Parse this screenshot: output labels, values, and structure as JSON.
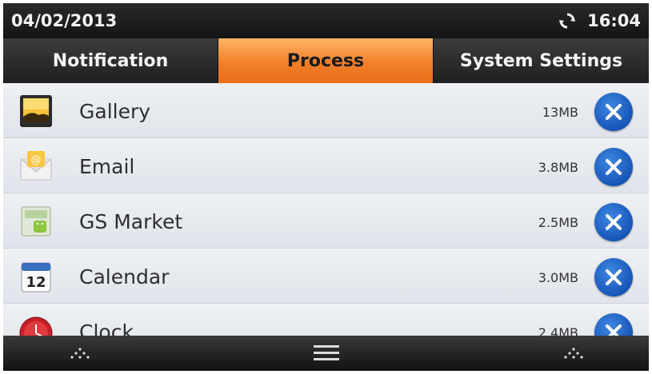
{
  "status_bar": {
    "date": "04/02/2013",
    "time": "16:04",
    "sync_icon": "sync-icon"
  },
  "tabs": [
    {
      "label": "Notification",
      "active": false
    },
    {
      "label": "Process",
      "active": true
    },
    {
      "label": "System Settings",
      "active": false
    }
  ],
  "processes": [
    {
      "name": "Gallery",
      "size": "13MB",
      "icon": "gallery-icon"
    },
    {
      "name": "Email",
      "size": "3.8MB",
      "icon": "email-icon"
    },
    {
      "name": "GS Market",
      "size": "2.5MB",
      "icon": "market-icon"
    },
    {
      "name": "Calendar",
      "size": "3.0MB",
      "icon": "calendar-icon",
      "icon_text": "12"
    },
    {
      "name": "Clock",
      "size": "2.4MB",
      "icon": "clock-icon"
    }
  ],
  "bottom_nav": {
    "left": "dots-icon",
    "center": "menu-icon",
    "right": "dots-icon"
  },
  "colors": {
    "active_tab": "#f07f2a",
    "kill_button": "#1656b8"
  }
}
